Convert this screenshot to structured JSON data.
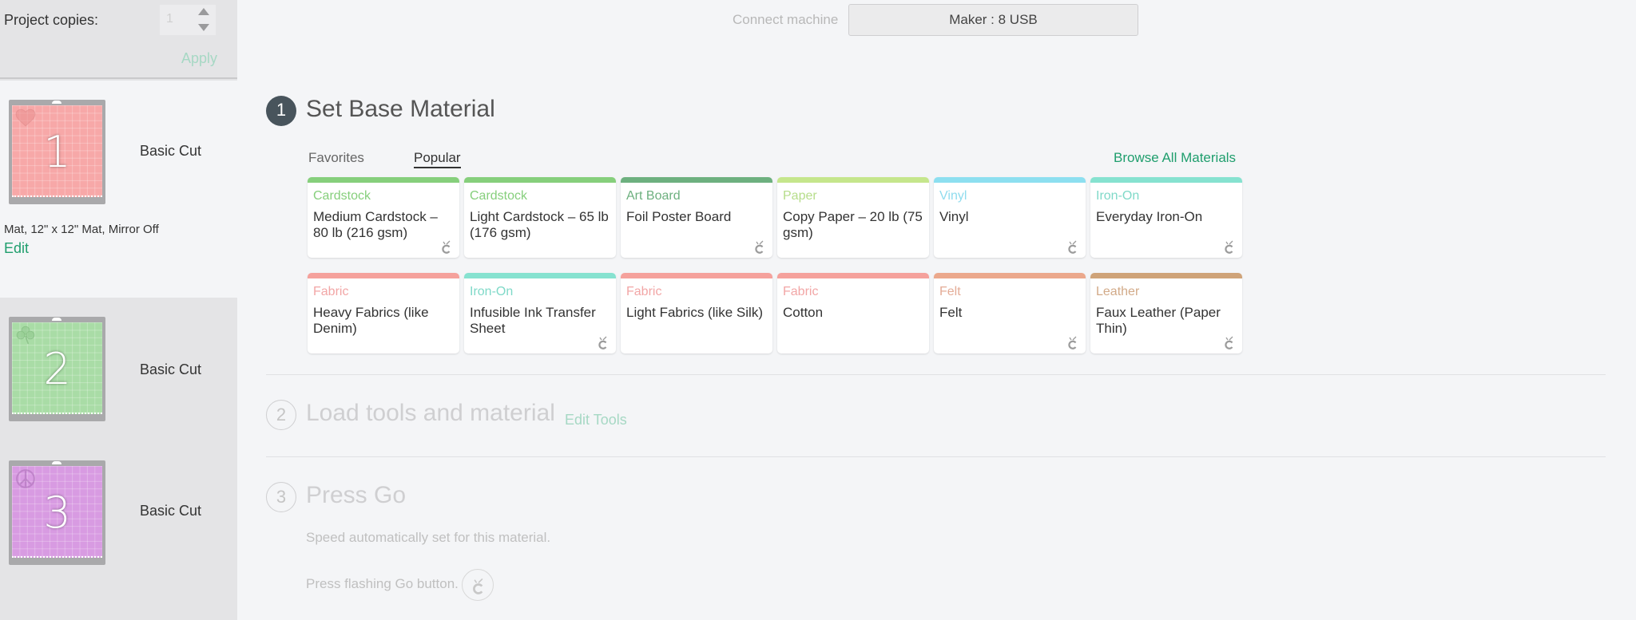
{
  "sidebar": {
    "copies_label": "Project copies:",
    "copies_value": "1",
    "apply_label": "Apply",
    "mats": [
      {
        "number": "1",
        "name": "Basic Cut",
        "shape": "heart-icon",
        "color": "#f7a8a8",
        "description": "Mat, 12\" x 12\" Mat, Mirror Off",
        "edit_label": "Edit",
        "selected": true
      },
      {
        "number": "2",
        "name": "Basic Cut",
        "shape": "shamrock-icon",
        "color": "#a9dca6",
        "selected": false
      },
      {
        "number": "3",
        "name": "Basic Cut",
        "shape": "peace-icon",
        "color": "#d89be2",
        "selected": false
      }
    ]
  },
  "header": {
    "connect_label": "Connect machine",
    "machine_button": "Maker : 8 USB"
  },
  "steps": [
    {
      "number": "1",
      "title": "Set Base Material",
      "active": true
    },
    {
      "number": "2",
      "title": "Load tools and material",
      "active": false,
      "action": "Edit Tools"
    },
    {
      "number": "3",
      "title": "Press Go",
      "active": false,
      "speed_text": "Speed automatically set for this material.",
      "go_text": "Press flashing Go button."
    }
  ],
  "material_tabs": {
    "tabs": [
      "Favorites",
      "Popular"
    ],
    "selected": "Popular",
    "browse_all": "Browse All Materials"
  },
  "materials": [
    {
      "category": "Cardstock",
      "name": "Medium Cardstock – 80 lb (216 gsm)",
      "bar_color": "#86cf7c",
      "cat_color": "#86cf7c",
      "cricut_icon": true
    },
    {
      "category": "Cardstock",
      "name": "Light Cardstock – 65 lb (176 gsm)",
      "bar_color": "#86cf7c",
      "cat_color": "#86cf7c",
      "cricut_icon": false
    },
    {
      "category": "Art Board",
      "name": "Foil Poster Board",
      "bar_color": "#6db07f",
      "cat_color": "#6db07f",
      "cricut_icon": true
    },
    {
      "category": "Paper",
      "name": "Copy Paper – 20 lb (75 gsm)",
      "bar_color": "#c5e68c",
      "cat_color": "#b6dd8a",
      "cricut_icon": false
    },
    {
      "category": "Vinyl",
      "name": "Vinyl",
      "bar_color": "#8ddff0",
      "cat_color": "#8fdcee",
      "cricut_icon": true
    },
    {
      "category": "Iron-On",
      "name": "Everyday Iron-On",
      "bar_color": "#86e2d0",
      "cat_color": "#7fd9c8",
      "cricut_icon": true
    },
    {
      "category": "Fabric",
      "name": "Heavy Fabrics (like Denim)",
      "bar_color": "#f5a19c",
      "cat_color": "#f2a6a6",
      "cricut_icon": false
    },
    {
      "category": "Iron-On",
      "name": "Infusible Ink Transfer Sheet",
      "bar_color": "#86e2d0",
      "cat_color": "#7fd9c8",
      "cricut_icon": true
    },
    {
      "category": "Fabric",
      "name": "Light Fabrics (like Silk)",
      "bar_color": "#f5a19c",
      "cat_color": "#f2a6a6",
      "cricut_icon": false
    },
    {
      "category": "Fabric",
      "name": "Cotton",
      "bar_color": "#f5a19c",
      "cat_color": "#f2a6a6",
      "cricut_icon": false
    },
    {
      "category": "Felt",
      "name": "Felt",
      "bar_color": "#eba88c",
      "cat_color": "#e4ac97",
      "cricut_icon": true
    },
    {
      "category": "Leather",
      "name": "Faux Leather (Paper Thin)",
      "bar_color": "#cfa379",
      "cat_color": "#d2aa88",
      "cricut_icon": true
    }
  ],
  "colors": {
    "accent": "#1f9e6d",
    "accent_disabled": "#a6d8c4",
    "active_step": "#48545c"
  }
}
